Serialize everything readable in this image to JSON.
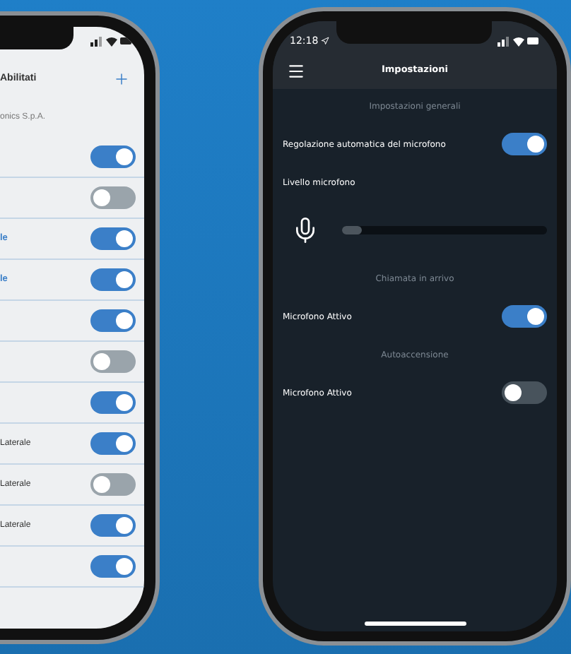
{
  "left_phone": {
    "header": {
      "title": "Abilitati"
    },
    "subtitle": "onics S.p.A.",
    "rows": [
      {
        "on": true
      },
      {
        "on": false
      },
      {
        "kind": "accent",
        "label": "le",
        "on": true
      },
      {
        "kind": "accent",
        "label": "le",
        "on": true
      },
      {
        "on": true
      },
      {
        "on": false
      },
      {
        "on": true
      },
      {
        "kind": "normal",
        "label": "Laterale",
        "on": true
      },
      {
        "kind": "normal",
        "label": "Laterale",
        "on": false
      },
      {
        "kind": "normal",
        "label": "Laterale",
        "on": true
      },
      {
        "on": true
      }
    ]
  },
  "right_phone": {
    "status_bar": {
      "time": "12:18"
    },
    "header": {
      "title": "Impostazioni"
    },
    "sections": [
      {
        "heading": "Impostazioni generali",
        "items": [
          {
            "kind": "toggle",
            "label": "Regolazione automatica del microfono",
            "on": true
          },
          {
            "kind": "label",
            "label": "Livello microfono"
          },
          {
            "kind": "slider",
            "level": 0
          }
        ]
      },
      {
        "heading": "Chiamata in arrivo",
        "items": [
          {
            "kind": "toggle",
            "label": "Microfono Attivo",
            "on": true
          }
        ]
      },
      {
        "heading": "Autoaccensione",
        "items": [
          {
            "kind": "toggle",
            "label": "Microfono Attivo",
            "on": false
          }
        ]
      }
    ]
  }
}
